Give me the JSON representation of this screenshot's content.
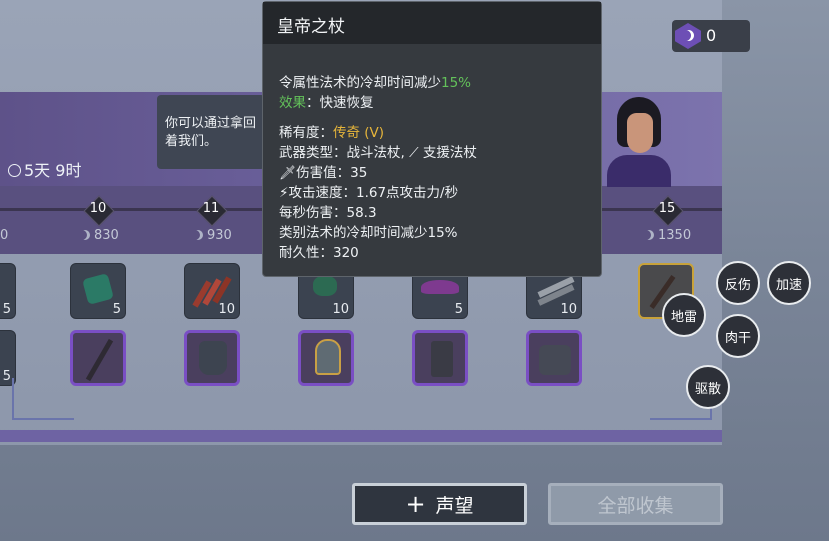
{
  "dialog": {
    "text": "你可以通过拿回\n着我们。"
  },
  "timer": "5天 9时",
  "currency": {
    "value": "0"
  },
  "timeline": [
    {
      "level": "",
      "cost": "0"
    },
    {
      "level": "10",
      "cost": "830"
    },
    {
      "level": "11",
      "cost": "930"
    },
    {
      "level": "15",
      "cost": "1350"
    }
  ],
  "resources": [
    {
      "name": "red-item",
      "qty": "5"
    },
    {
      "name": "gem",
      "qty": "5"
    },
    {
      "name": "wood-planks",
      "qty": "10"
    },
    {
      "name": "moss",
      "qty": "10"
    },
    {
      "name": "cloth",
      "qty": "5"
    },
    {
      "name": "metal-pipes",
      "qty": "10"
    }
  ],
  "left_equip_qty": "5",
  "tooltip": {
    "title": "皇帝之杖",
    "l1a": "令属性法术的冷却时间减少",
    "l1b": "15%",
    "l2a": "效果",
    "l2b": "：快速恢复",
    "l3a": "稀有度：",
    "l3b": "传奇 (V)",
    "l4": "武器类型：战斗法杖,",
    "l4b": "支援法杖",
    "l5": "伤害值：35",
    "l6": "攻击速度：1.67点攻击力/秒",
    "l7": "每秒伤害：58.3",
    "l8": "类别法术的冷却时间减少15%",
    "l9": "耐久性：320"
  },
  "skills": {
    "fanshang": "反伤",
    "jiasu": "加速",
    "dilei": "地雷",
    "rougan": "肉干",
    "qusan": "驱散"
  },
  "buttons": {
    "reputation": "声望",
    "collect_all": "全部收集"
  }
}
